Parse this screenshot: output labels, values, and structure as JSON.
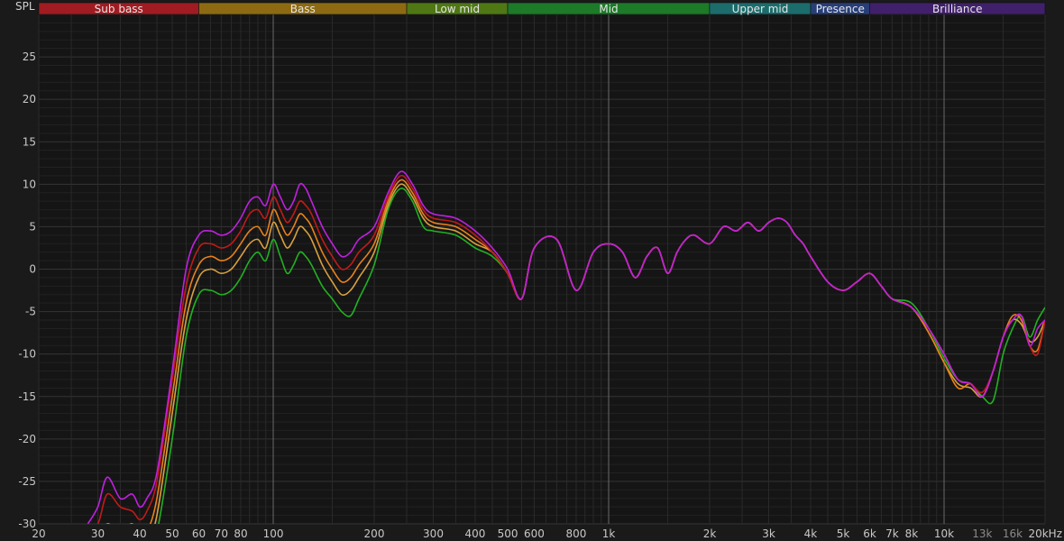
{
  "chart_data": {
    "type": "line",
    "ylabel": "SPL",
    "xlabel": "",
    "xscale": "log",
    "xlim": [
      20,
      20000
    ],
    "ylim": [
      -30,
      30
    ],
    "grid": true,
    "x_ticks": [
      {
        "v": 20,
        "t": "20"
      },
      {
        "v": 30,
        "t": "30"
      },
      {
        "v": 40,
        "t": "40"
      },
      {
        "v": 50,
        "t": "50"
      },
      {
        "v": 60,
        "t": "60"
      },
      {
        "v": 70,
        "t": "70"
      },
      {
        "v": 80,
        "t": "80"
      },
      {
        "v": 100,
        "t": "100"
      },
      {
        "v": 200,
        "t": "200"
      },
      {
        "v": 300,
        "t": "300"
      },
      {
        "v": 400,
        "t": "400"
      },
      {
        "v": 500,
        "t": "500"
      },
      {
        "v": 600,
        "t": "600"
      },
      {
        "v": 800,
        "t": "800"
      },
      {
        "v": 1000,
        "t": "1k"
      },
      {
        "v": 2000,
        "t": "2k"
      },
      {
        "v": 3000,
        "t": "3k"
      },
      {
        "v": 4000,
        "t": "4k"
      },
      {
        "v": 5000,
        "t": "5k"
      },
      {
        "v": 6000,
        "t": "6k"
      },
      {
        "v": 7000,
        "t": "7k"
      },
      {
        "v": 8000,
        "t": "8k"
      },
      {
        "v": 10000,
        "t": "10k"
      },
      {
        "v": 13000,
        "t": "13k",
        "dim": true
      },
      {
        "v": 16000,
        "t": "16k",
        "dim": true
      },
      {
        "v": 20000,
        "t": "20kHz"
      }
    ],
    "y_ticks": [
      25,
      20,
      15,
      10,
      5,
      0,
      -5,
      -10,
      -15,
      -20,
      -25,
      -30
    ],
    "bands": [
      {
        "name": "Sub bass",
        "from": 20,
        "to": 60,
        "color": "#a01c22"
      },
      {
        "name": "Bass",
        "from": 60,
        "to": 250,
        "color": "#8d6a12"
      },
      {
        "name": "Low mid",
        "from": 250,
        "to": 500,
        "color": "#4f7814"
      },
      {
        "name": "Mid",
        "from": 500,
        "to": 2000,
        "color": "#1c7a28"
      },
      {
        "name": "Upper mid",
        "from": 2000,
        "to": 4000,
        "color": "#1c6c6c"
      },
      {
        "name": "Presence",
        "from": 4000,
        "to": 6000,
        "color": "#283e78"
      },
      {
        "name": "Brilliance",
        "from": 6000,
        "to": 20000,
        "color": "#40206a"
      }
    ],
    "x": [
      28,
      30,
      32,
      35,
      38,
      40,
      42,
      45,
      50,
      55,
      60,
      65,
      70,
      75,
      80,
      85,
      90,
      95,
      100,
      105,
      110,
      115,
      120,
      125,
      130,
      140,
      150,
      160,
      170,
      180,
      200,
      220,
      240,
      260,
      280,
      300,
      350,
      400,
      450,
      500,
      550,
      600,
      700,
      800,
      900,
      1000,
      1100,
      1200,
      1300,
      1400,
      1500,
      1600,
      1700,
      1800,
      2000,
      2200,
      2400,
      2600,
      2800,
      3000,
      3200,
      3400,
      3600,
      3800,
      4000,
      4500,
      5000,
      5500,
      6000,
      6500,
      7000,
      8000,
      9000,
      10000,
      11000,
      12000,
      13000,
      14000,
      15000,
      16000,
      17000,
      18000,
      19000,
      20000
    ],
    "series": [
      {
        "color": "#c020e0",
        "values": [
          -30,
          -28,
          -24.5,
          -27,
          -26.5,
          -28,
          -27,
          -24,
          -12,
          0,
          4,
          4.5,
          4,
          4.5,
          6,
          8,
          8.5,
          7.5,
          10,
          8.5,
          7,
          8,
          10,
          9.5,
          8,
          5,
          3,
          1.5,
          2,
          3.5,
          5,
          9,
          11.5,
          10,
          7.5,
          6.5,
          6,
          4.5,
          2.5,
          0,
          -3.5,
          2.5,
          3.5,
          -2.5,
          2,
          3,
          2,
          -1,
          1.5,
          2.5,
          -0.5,
          2,
          3.5,
          4,
          3,
          5,
          4.5,
          5.5,
          4.5,
          5.5,
          6,
          5.5,
          4,
          3,
          1.5,
          -1.5,
          -2.5,
          -1.5,
          -0.5,
          -2,
          -3.5,
          -4.5,
          -7,
          -10,
          -13,
          -13.5,
          -15,
          -12,
          -8,
          -6,
          -5.5,
          -9,
          -7,
          -6
        ]
      },
      {
        "color": "#c21a1a",
        "values": [
          -30,
          -30,
          -26.5,
          -28,
          -28.5,
          -29.5,
          -28.5,
          -25,
          -13,
          -2,
          2.5,
          3,
          2.5,
          3,
          4.5,
          6.5,
          7,
          6,
          8.5,
          7,
          5.5,
          6.5,
          8,
          7.5,
          6.5,
          3.5,
          1.5,
          0,
          0.5,
          2,
          4,
          8.5,
          11,
          9.5,
          7,
          6,
          5.5,
          4,
          2,
          -0.5,
          -3.5,
          2.5,
          3.5,
          -2.5,
          2,
          3,
          2,
          -1,
          1.5,
          2.5,
          -0.5,
          2,
          3.5,
          4,
          3,
          5,
          4.5,
          5.5,
          4.5,
          5.5,
          6,
          5.5,
          4,
          3,
          1.5,
          -1.5,
          -2.5,
          -1.5,
          -0.5,
          -2,
          -3.5,
          -4.5,
          -7,
          -10,
          -13,
          -13.5,
          -14.5,
          -12,
          -8,
          -6,
          -5.5,
          -9,
          -10,
          -6
        ]
      },
      {
        "color": "#e8801c",
        "values": [
          -31,
          -32,
          -30,
          -31,
          -30,
          -32,
          -31,
          -27,
          -15,
          -4,
          0.5,
          1.5,
          1,
          1.5,
          3,
          4.5,
          5,
          4,
          7,
          5.5,
          4,
          5,
          6.5,
          6,
          5,
          2,
          0,
          -1.5,
          -1,
          0.5,
          3,
          8,
          10.5,
          9,
          6.5,
          5.5,
          5,
          3.5,
          2,
          -0.5,
          -3.5,
          2.5,
          3.5,
          -2.5,
          2,
          3,
          2,
          -1,
          1.5,
          2.5,
          -0.5,
          2,
          3.5,
          4,
          3,
          5,
          4.5,
          5.5,
          4.5,
          5.5,
          6,
          5.5,
          4,
          3,
          1.5,
          -1.5,
          -2.5,
          -1.5,
          -0.5,
          -2,
          -3.5,
          -4.5,
          -7.5,
          -11,
          -14,
          -13.5,
          -15,
          -12,
          -8,
          -5.5,
          -6,
          -9,
          -9.5,
          -6
        ]
      },
      {
        "color": "#d8a040",
        "values": [
          -32,
          -32,
          -31,
          -32,
          -31,
          -32,
          -32,
          -29,
          -17,
          -6,
          -1,
          0,
          -0.5,
          0,
          1.5,
          3,
          3.5,
          2.5,
          5.5,
          4,
          2.5,
          3.5,
          5,
          4.5,
          3.5,
          0.5,
          -1.5,
          -3,
          -2.5,
          -1,
          2,
          7.5,
          10,
          8.5,
          6,
          5,
          4.5,
          3,
          2,
          -0.5,
          -3.5,
          2.5,
          3.5,
          -2.5,
          2,
          3,
          2,
          -1,
          1.5,
          2.5,
          -0.5,
          2,
          3.5,
          4,
          3,
          5,
          4.5,
          5.5,
          4.5,
          5.5,
          6,
          5.5,
          4,
          3,
          1.5,
          -1.5,
          -2.5,
          -1.5,
          -0.5,
          -2,
          -3.5,
          -4.5,
          -7.5,
          -11,
          -13.5,
          -14,
          -15,
          -12,
          -8,
          -6,
          -6.5,
          -8.5,
          -8,
          -6
        ]
      },
      {
        "color": "#22b022",
        "values": [
          -33,
          -33,
          -32,
          -33,
          -32,
          -33,
          -33,
          -31,
          -20,
          -8,
          -3,
          -2.5,
          -3,
          -2.5,
          -1,
          1,
          2,
          1,
          3.5,
          1.5,
          -0.5,
          0.5,
          2,
          1.5,
          0.5,
          -2,
          -3.5,
          -5,
          -5.5,
          -3.5,
          0.5,
          7,
          9.5,
          8,
          5,
          4.5,
          4,
          2.5,
          1.5,
          -0.5,
          -3.5,
          2.5,
          3.5,
          -2.5,
          2,
          3,
          2,
          -1,
          1.5,
          2.5,
          -0.5,
          2,
          3.5,
          4,
          3,
          5,
          4.5,
          5.5,
          4.5,
          5.5,
          6,
          5.5,
          4,
          3,
          1.5,
          -1.5,
          -2.5,
          -1.5,
          -0.5,
          -2,
          -3.5,
          -4,
          -7,
          -10.5,
          -13,
          -13.5,
          -15,
          -15.5,
          -10,
          -7,
          -5.5,
          -8,
          -6,
          -4.5
        ]
      }
    ]
  }
}
